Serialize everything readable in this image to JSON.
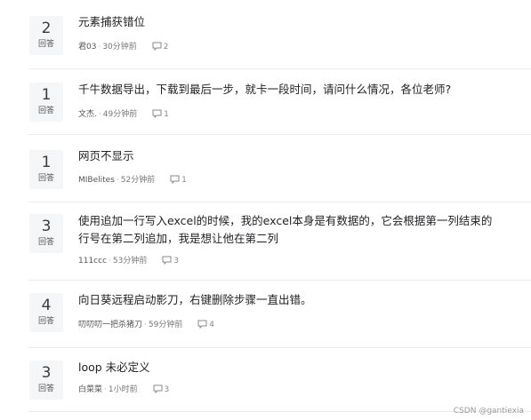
{
  "questions": [
    {
      "count": "2",
      "label": "回答",
      "title": "元素捕获错位",
      "author": "君03",
      "time": "30分钟前",
      "comments": "2"
    },
    {
      "count": "1",
      "label": "回答",
      "title": "千牛数据导出，下载到最后一步，就卡一段时间，请问什么情况，各位老师?",
      "author": "文杰.",
      "time": "49分钟前",
      "comments": "1"
    },
    {
      "count": "1",
      "label": "回答",
      "title": "网页不显示",
      "author": "MIBelites",
      "time": "52分钟前",
      "comments": "1"
    },
    {
      "count": "3",
      "label": "回答",
      "title": "使用追加一行写入excel的时候，我的excel本身是有数据的，它会根据第一列结束的行号在第二列追加，我是想让他在第二列",
      "author": "111ccc",
      "time": "53分钟前",
      "comments": "3"
    },
    {
      "count": "4",
      "label": "回答",
      "title": "向日葵远程启动影刀，右键删除步骤一直出错。",
      "author": "叨叨叨一把杀猪刀",
      "time": "59分钟前",
      "comments": "4"
    },
    {
      "count": "3",
      "label": "回答",
      "title": "loop 未必定义",
      "author": "白菜菜",
      "time": "1小时前",
      "comments": "3"
    }
  ],
  "watermark": "CSDN @gantiexia"
}
